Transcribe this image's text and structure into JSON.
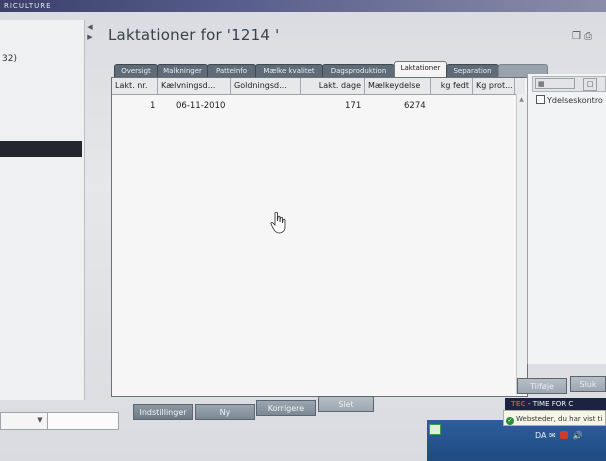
{
  "topbar": {
    "text": "RICULTURE"
  },
  "left_panel": {
    "number_fragment": "32)"
  },
  "window": {
    "title": "Laktationer for '1214 '",
    "icons": [
      "window-restore-icon",
      "print-icon"
    ]
  },
  "tabs": [
    {
      "label": "Oversigt",
      "active": false
    },
    {
      "label": "Malkninger",
      "active": false
    },
    {
      "label": "Pattelnfo",
      "active": false
    },
    {
      "label": "Mælke kvalitet",
      "active": false
    },
    {
      "label": "Dagsproduktion",
      "active": false
    },
    {
      "label": "Laktationer",
      "active": true
    },
    {
      "label": "Separation",
      "active": false
    },
    {
      "label": "",
      "active": false
    }
  ],
  "grid": {
    "columns": [
      "Lakt. nr.",
      "Kælvningsd...",
      "Goldningsd...",
      "Lakt. dage",
      "Mælkeydelse",
      "kg fedt",
      "Kg prot..."
    ],
    "rows": [
      {
        "lakt_nr": "1",
        "kaelvningsdato": "06-11-2010",
        "goldningsdato": "",
        "lakt_dage": "171",
        "maelkeydelse": "6274",
        "kg_fedt": "",
        "kg_prot": ""
      }
    ]
  },
  "right_panel": {
    "checkbox_label": "Ydelseskontro",
    "checked": false
  },
  "buttons": {
    "indstillinger": "Indstillinger",
    "ny": "Ny",
    "korrigere": "Korrigere",
    "slet": "Slet",
    "tilfoeje": "Tilføje",
    "right_partial": "Sluk"
  },
  "tec_banner": {
    "brand": "TEC",
    "slogan": "- TIME FOR C"
  },
  "notification": {
    "text": "Websteder, du har vist ti"
  },
  "tray": {
    "lang": "DA"
  },
  "colors": {
    "tab_bg": "#5f6c78",
    "button_bg": "#8c97a2",
    "taskbar": "#2d5f9a"
  }
}
